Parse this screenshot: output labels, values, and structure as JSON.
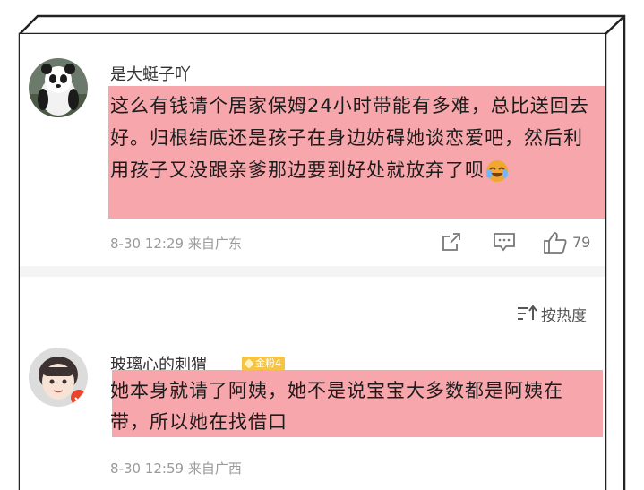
{
  "comments": [
    {
      "username": "是大蜓子吖",
      "text": "这么有钱请个居家保姆24小时带能有多难，总比送回去好。归根结底还是孩子在身边妨碍她谈恋爱吧，然后利用孩子又没跟亲爹那边要到好处就放弃了呗",
      "time": "8-30 12:29",
      "location": "来自广东",
      "likes": "79",
      "emoji_icon": "laugh-cry-emoji"
    },
    {
      "username": "玻璃心的刺猬",
      "badge": "金粉4",
      "text": "她本身就请了阿姨，她不是说宝宝大多数都是阿姨在带，所以她在找借口",
      "time": "8-30 12:59",
      "location": "来自广西"
    }
  ],
  "sort": {
    "label": "按热度"
  },
  "colors": {
    "highlight": "#f7a6ab",
    "badge": "#f6c343",
    "meta": "#9a9a9a"
  }
}
